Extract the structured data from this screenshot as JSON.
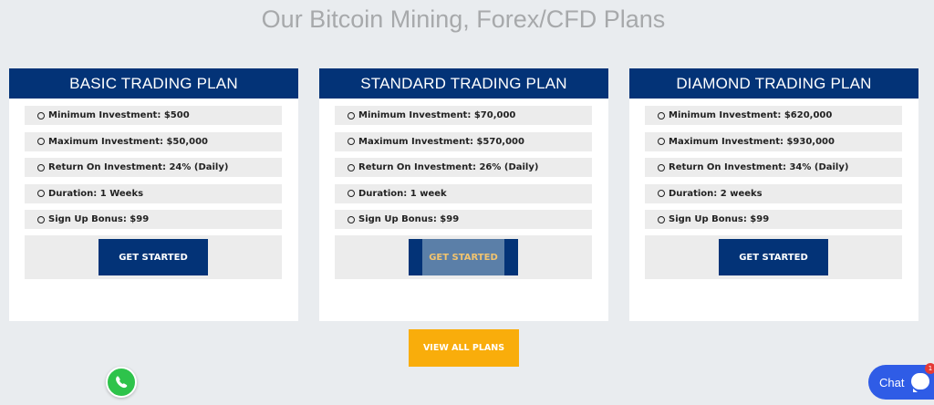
{
  "section": {
    "title": "Our Bitcoin Mining, Forex/CFD Plans"
  },
  "plans": [
    {
      "name": "BASIC TRADING PLAN",
      "features": [
        "Minimum Investment: $500",
        "Maximum Investment: $50,000",
        "Return On Investment: 24% (Daily)",
        "Duration: 1 Weeks",
        "Sign Up Bonus: $99"
      ],
      "cta": "GET STARTED"
    },
    {
      "name": "STANDARD TRADING PLAN",
      "features": [
        "Minimum Investment: $70,000",
        "Maximum Investment: $570,000",
        "Return On Investment: 26% (Daily)",
        "Duration: 1 week",
        "Sign Up Bonus: $99"
      ],
      "cta": "GET STARTED"
    },
    {
      "name": "DIAMOND TRADING PLAN",
      "features": [
        "Minimum Investment: $620,000",
        "Maximum Investment: $930,000",
        "Return On Investment: 34% (Daily)",
        "Duration: 2 weeks",
        "Sign Up Bonus: $99"
      ],
      "cta": "GET STARTED"
    }
  ],
  "view_all": {
    "label": "VIEW ALL PLANS"
  },
  "chat": {
    "label": "Chat",
    "badge": "1"
  },
  "colors": {
    "header_blue": "#033377",
    "cta_hover": "#5b7fa8",
    "view_all_orange": "#f9ad0b",
    "whatsapp_green": "#2ec34b",
    "chat_blue": "#2f5ce6"
  },
  "icons": {
    "bullet": "circle-outline-icon",
    "whatsapp": "whatsapp-icon",
    "chat": "chat-bubble-icon"
  }
}
